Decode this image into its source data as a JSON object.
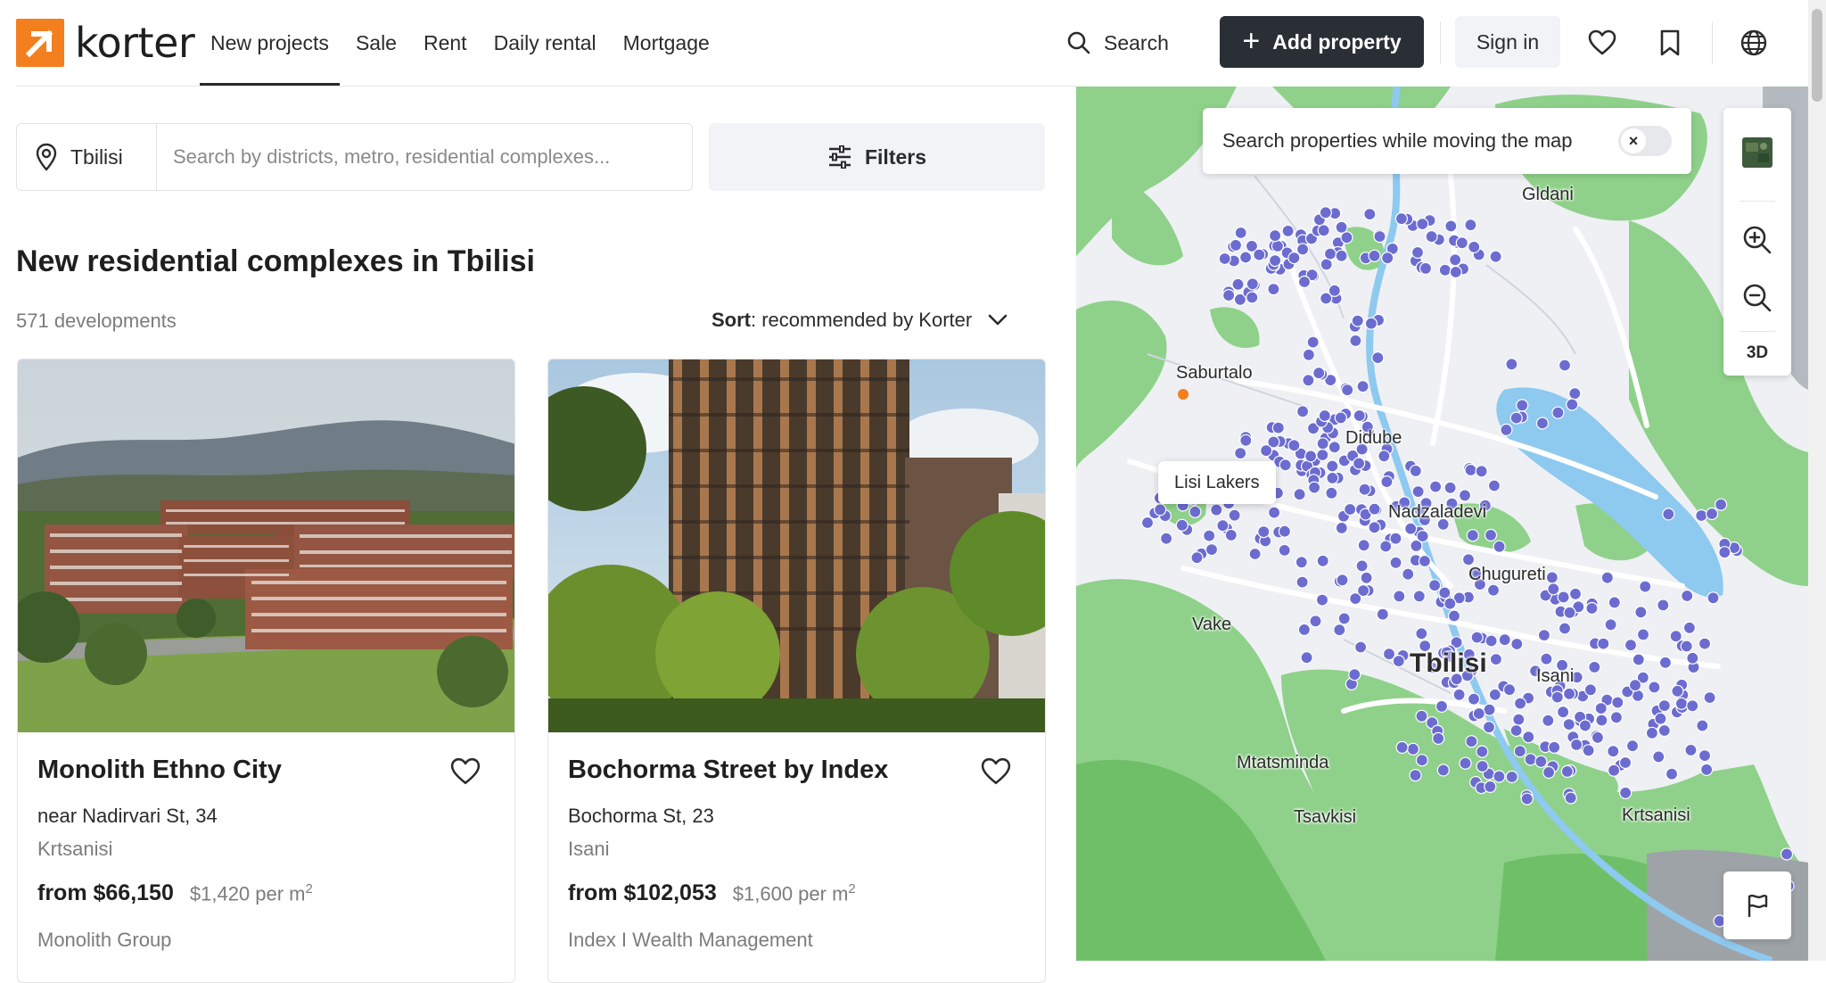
{
  "brand": {
    "name": "korter",
    "accent": "#f47f1f"
  },
  "nav": {
    "items": [
      {
        "label": "New projects",
        "active": true
      },
      {
        "label": "Sale"
      },
      {
        "label": "Rent"
      },
      {
        "label": "Daily rental"
      },
      {
        "label": "Mortgage"
      }
    ]
  },
  "header": {
    "search_label": "Search",
    "add_property_label": "Add property",
    "sign_in_label": "Sign in",
    "icons": [
      "search-icon",
      "plus-icon",
      "heart-icon",
      "bookmark-icon",
      "globe-icon"
    ]
  },
  "search": {
    "city": "Tbilisi",
    "placeholder": "Search by districts, metro, residential complexes...",
    "filters_label": "Filters"
  },
  "listing": {
    "title": "New residential complexes in Tbilisi",
    "count": "571 developments",
    "sort_prefix": "Sort",
    "sort_value": ": recommended by Korter"
  },
  "cards": [
    {
      "title": "Monolith Ethno City",
      "address": "near Nadirvari St, 34",
      "district": "Krtsanisi",
      "price": "from $66,150",
      "ppm": "$1,420 per m",
      "ppm_sup": "2",
      "developer": "Monolith Group"
    },
    {
      "title": "Bochorma Street by Index",
      "address": "Bochorma St, 23",
      "district": "Isani",
      "price": "from $102,053",
      "ppm": "$1,600 per m",
      "ppm_sup": "2",
      "developer": "Index I Wealth Management"
    }
  ],
  "map": {
    "toast": "Search properties while moving the map",
    "toggle_on": false,
    "ctrl_3d": "3D",
    "tooltip": "Lisi Lakers",
    "labels": {
      "gldani": "Gldani",
      "saburtalo": "Saburtalo",
      "didube": "Didube",
      "nadzaladevi": "Nadzaladevi",
      "chugureti": "Chugureti",
      "vake": "Vake",
      "tbilisi": "Tbilisi",
      "isani": "Isani",
      "mtatsminda": "Mtatsminda",
      "tsavkisi": "Tsavkisi",
      "krtsanisi": "Krtsanisi"
    },
    "colors": {
      "green": "#8fd18a",
      "water": "#8ec9f0",
      "marker": "#6c6cd0"
    }
  }
}
